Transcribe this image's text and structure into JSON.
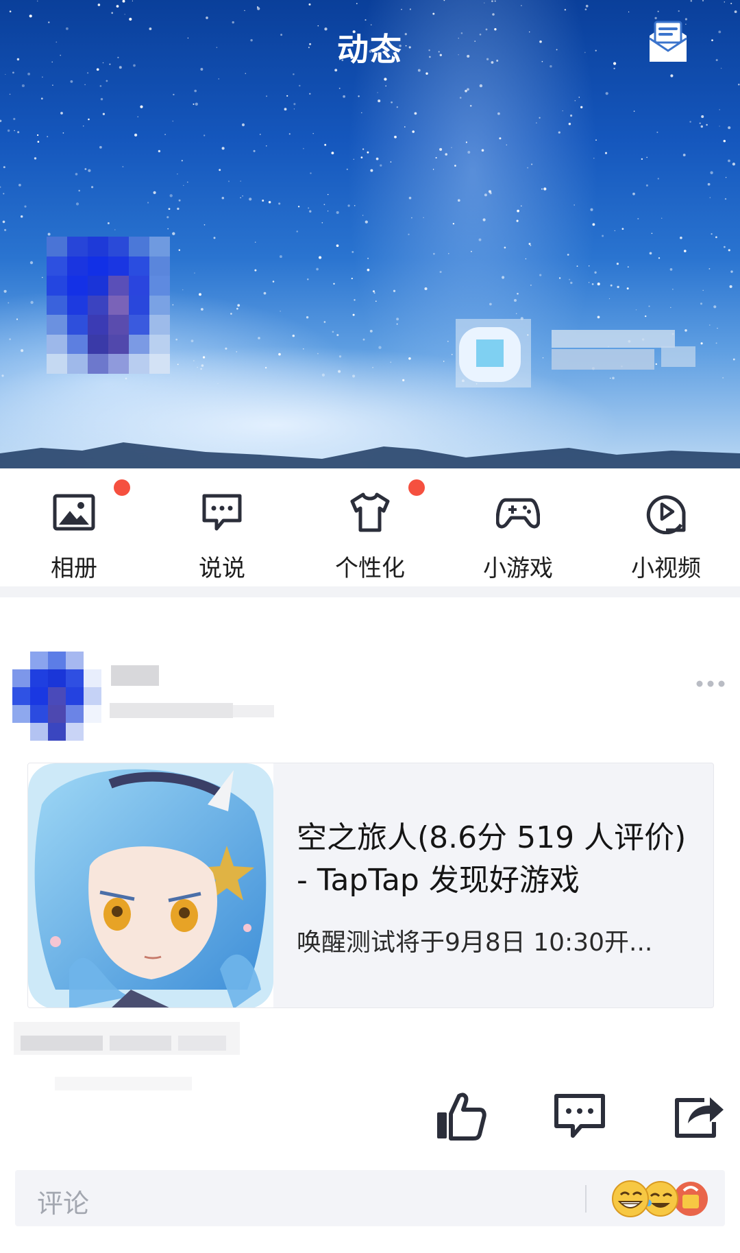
{
  "header": {
    "title": "动态",
    "mail_icon": "mail-icon"
  },
  "quicknav": {
    "items": [
      {
        "label": "相册",
        "icon": "photo-album-icon",
        "badge": true
      },
      {
        "label": "说说",
        "icon": "chat-bubble-icon",
        "badge": false
      },
      {
        "label": "个性化",
        "icon": "tshirt-icon",
        "badge": true
      },
      {
        "label": "小游戏",
        "icon": "gamepad-icon",
        "badge": false
      },
      {
        "label": "小视频",
        "icon": "play-video-icon",
        "badge": false
      }
    ],
    "badge_color": "#f5503f"
  },
  "post": {
    "card": {
      "title": "空之旅人(8.6分 519 人评价) - TapTap 发现好游戏",
      "description": "唤醒测试将于9月8日 10:30开..."
    },
    "actions": {
      "like_icon": "thumbs-up-icon",
      "comment_icon": "comment-icon",
      "share_icon": "share-icon"
    }
  },
  "comment_input": {
    "placeholder": "评论",
    "emoji_icon": "emoji-icon"
  },
  "colors": {
    "accent_dot": "#f5503f",
    "card_background": "#f3f4f8",
    "icon_dark": "#2b2e3a"
  }
}
